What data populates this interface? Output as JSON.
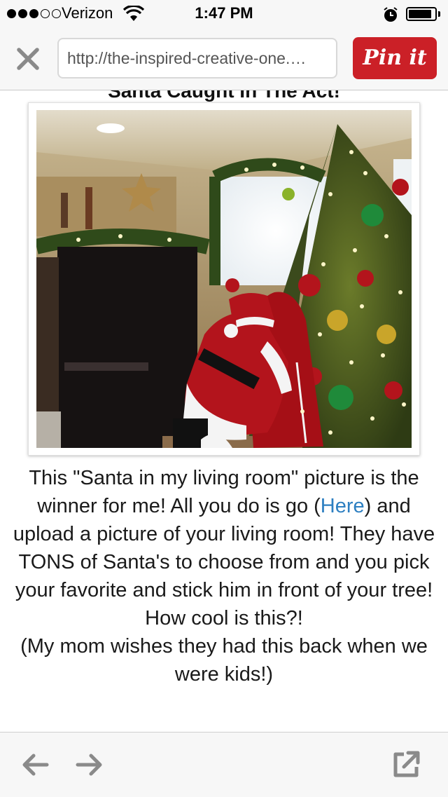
{
  "status_bar": {
    "carrier": "Verizon",
    "time": "1:47 PM",
    "signal_bars_filled": 3,
    "signal_bars_total": 5,
    "battery_level": 0.9,
    "icons": [
      "signal-dots",
      "wifi-icon",
      "alarm-icon",
      "battery-icon"
    ]
  },
  "nav": {
    "url": "http://the-inspired-creative-one.…",
    "pin_button_label": "Pin it",
    "close_icon": "close-icon"
  },
  "article": {
    "heading": "Santa Caught In The Act!",
    "image_alt": "Santa in living room beside decorated Christmas tree",
    "paragraph_part1": "This \"Santa in my living room\" picture is the winner for me! All you do is go (",
    "link_text": "Here",
    "paragraph_part2": ") and upload a picture of your living room! They have TONS of Santa's to choose from and you pick your favorite and stick him in front of your tree! How cool is this?!",
    "paragraph_line2": "(My mom wishes they had this back when we were kids!)"
  },
  "toolbar": {
    "icons": [
      "back-arrow-icon",
      "forward-arrow-icon",
      "share-external-icon"
    ]
  },
  "colors": {
    "pin_red": "#cb2027",
    "link_blue": "#2d7fc1",
    "bar_bg": "#f7f7f7"
  }
}
